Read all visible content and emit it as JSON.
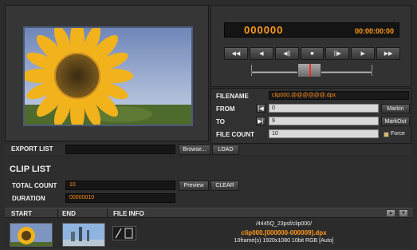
{
  "transport": {
    "frame_counter": "000000",
    "timecode": "00:00:00:00",
    "buttons": [
      "◀◀",
      "◀",
      "◀||",
      "■",
      "||▶",
      "▶",
      "▶▶"
    ]
  },
  "fields": {
    "filename_label": "FILENAME",
    "filename_value": "clip000.@@@@@@.dpx",
    "from_label": "FROM",
    "from_value": "0",
    "to_label": "TO",
    "to_value": "9",
    "file_count_label": "FILE COUNT",
    "file_count_value": "10",
    "mark_in": "MarkIn",
    "mark_out": "MarkOut",
    "force_label": "Force"
  },
  "export": {
    "label": "EXPORT LIST",
    "browse": "Browse...",
    "load": "LOAD"
  },
  "clip_list": {
    "title": "CLIP LIST",
    "total_count_label": "TOTAL COUNT",
    "total_count_value": "10",
    "duration_label": "DURATION",
    "duration_value": "00000010",
    "preview": "Preview",
    "clear": "CLEAR",
    "columns": {
      "start": "START",
      "end": "END",
      "file_info": "FILE INFO"
    },
    "rows": [
      {
        "path": "/4445Q_23psf/clip000/",
        "name": "clip000.[000000-000009].dpx",
        "meta": "10frame(s) 1920x1080 10bit RGB [Auto]"
      }
    ]
  },
  "colors": {
    "accent": "#ff9a1a",
    "panel": "#323232",
    "background": "#2c2c2c"
  }
}
